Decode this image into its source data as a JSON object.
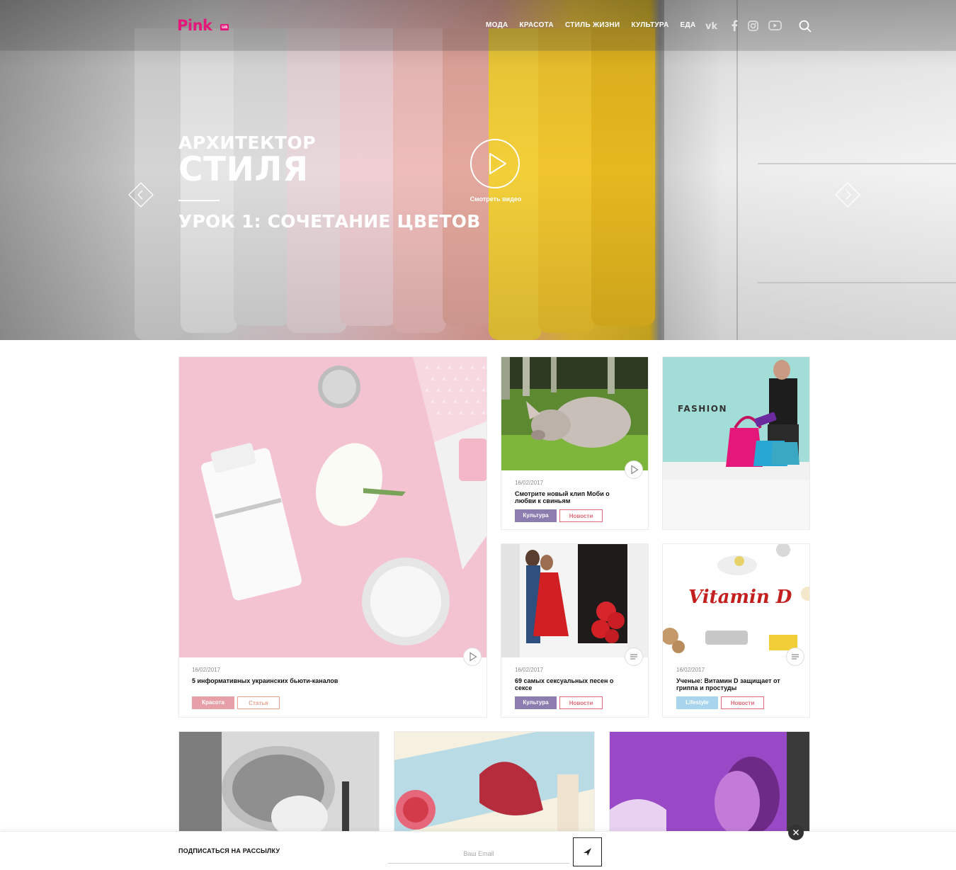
{
  "header": {
    "logo": "Pink",
    "logo_suffix": "ua",
    "nav": [
      "МОДА",
      "КРАСОТА",
      "СТИЛЬ ЖИЗНИ",
      "КУЛЬТУРА",
      "ЕДА"
    ],
    "social": [
      "vk-icon",
      "facebook-icon",
      "instagram-icon",
      "youtube-icon"
    ]
  },
  "hero": {
    "title_line1": "АРХИТЕКТОР",
    "title_line2": "СТИЛЯ",
    "subtitle": "УРОК 1: СОЧЕТАНИЕ ЦВЕТОВ",
    "video_label": "Смотреть видео"
  },
  "cards": [
    {
      "date": "16/02/2017",
      "title": "5 информативных украинских бьюти-каналов",
      "tags": [
        "Красота",
        "Статья"
      ],
      "icon": "play-icon"
    },
    {
      "date": "16/02/2017",
      "title": "Смотрите новый клип Моби о любви к свиньям",
      "tags": [
        "Культура",
        "Новости"
      ],
      "icon": "play-icon"
    },
    {
      "banner_text": "FASHION"
    },
    {
      "date": "16/02/2017",
      "title": "69 самых сексуальных песен о сексе",
      "tags": [
        "Культура",
        "Новости"
      ],
      "icon": "text-icon"
    },
    {
      "date": "16/02/2017",
      "title": "Ученые: Витамин D защищает от гриппа и простуды",
      "tags": [
        "Lifestyle",
        "Новости"
      ],
      "icon": "text-icon",
      "image_text": "Vitamin D"
    }
  ],
  "colors": {
    "brand": "#e5177b",
    "tag_beauty": "#e8a0a8",
    "tag_culture": "#8c7cb0",
    "tag_lifestyle": "#a9d4ee",
    "tag_outline": "#e06a7a"
  },
  "subscribe": {
    "label": "ПОДПИСАТЬСЯ НА РАССЫЛКУ",
    "placeholder": "Ваш Email"
  }
}
